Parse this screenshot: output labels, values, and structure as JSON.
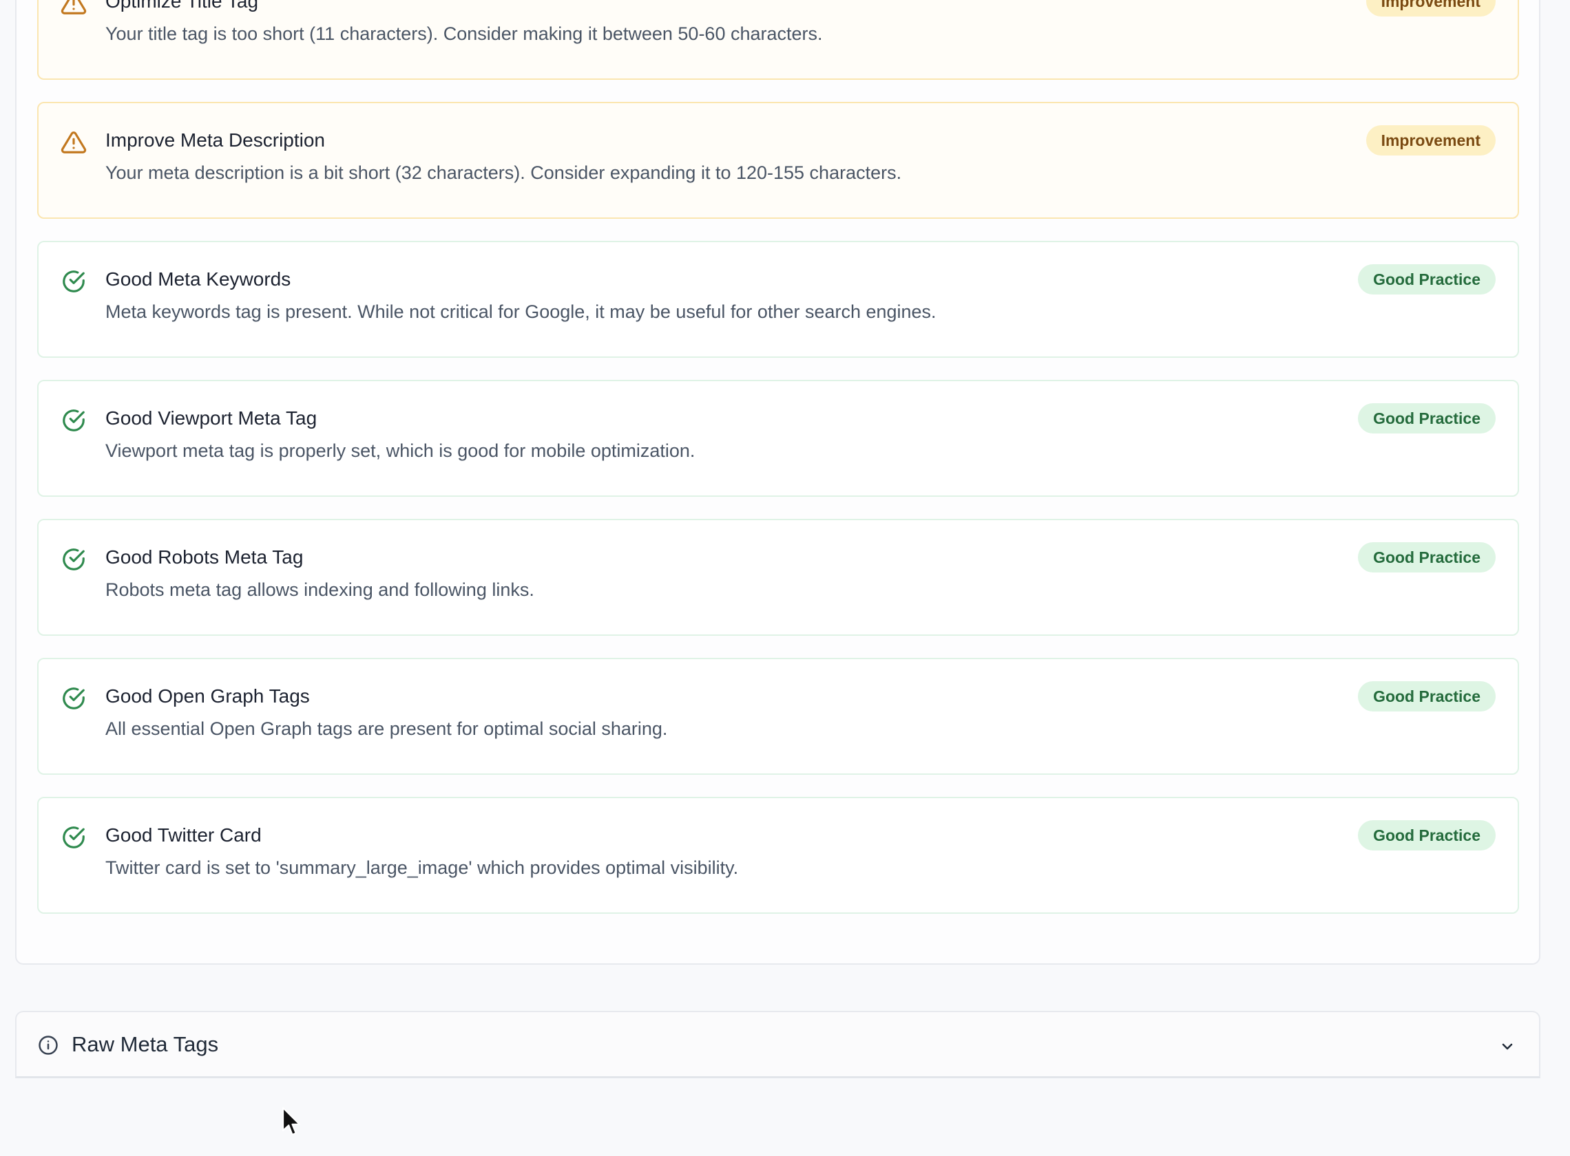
{
  "recommendations": [
    {
      "type": "improvement",
      "icon": "warning-icon",
      "title": "Optimize Title Tag",
      "description": "Your title tag is too short (11 characters). Consider making it between 50-60 characters.",
      "badge": "Improvement"
    },
    {
      "type": "improvement",
      "icon": "warning-icon",
      "title": "Improve Meta Description",
      "description": "Your meta description is a bit short (32 characters). Consider expanding it to 120-155 characters.",
      "badge": "Improvement"
    },
    {
      "type": "good",
      "icon": "check-circle-icon",
      "title": "Good Meta Keywords",
      "description": "Meta keywords tag is present. While not critical for Google, it may be useful for other search engines.",
      "badge": "Good Practice"
    },
    {
      "type": "good",
      "icon": "check-circle-icon",
      "title": "Good Viewport Meta Tag",
      "description": "Viewport meta tag is properly set, which is good for mobile optimization.",
      "badge": "Good Practice"
    },
    {
      "type": "good",
      "icon": "check-circle-icon",
      "title": "Good Robots Meta Tag",
      "description": "Robots meta tag allows indexing and following links.",
      "badge": "Good Practice"
    },
    {
      "type": "good",
      "icon": "check-circle-icon",
      "title": "Good Open Graph Tags",
      "description": "All essential Open Graph tags are present for optimal social sharing.",
      "badge": "Good Practice"
    },
    {
      "type": "good",
      "icon": "check-circle-icon",
      "title": "Good Twitter Card",
      "description": "Twitter card is set to 'summary_large_image' which provides optimal visibility.",
      "badge": "Good Practice"
    }
  ],
  "raw_meta": {
    "title": "Raw Meta Tags",
    "icon": "info-icon",
    "toggle_icon": "chevron-down-icon"
  },
  "colors": {
    "improvement_icon": "#c2781f",
    "good_icon": "#2f8a4e",
    "improvement_border": "#fbe6b0",
    "good_border": "#dff3e6"
  }
}
